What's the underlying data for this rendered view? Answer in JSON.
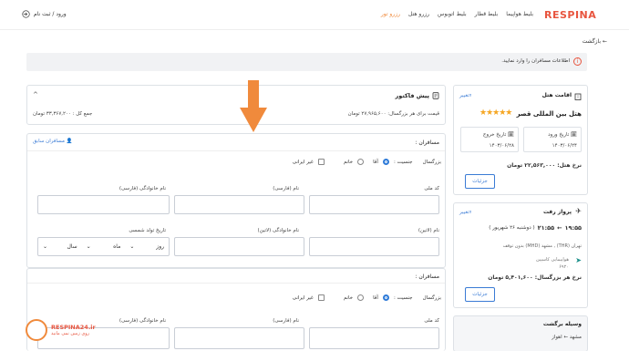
{
  "nav": {
    "logo": "RESPINA",
    "links": [
      "بلیط هواپیما",
      "بلیط قطار",
      "بلیط اتوبوس",
      "رزرو هتل",
      "رزرو تور"
    ],
    "login": "ورود / ثبت نام"
  },
  "back": "← بازگشت",
  "notice": "اطلاعات مسافران را وارد نمایید.",
  "hotel": {
    "header": "اقامت هتل",
    "change": "تغییر",
    "name": "هتل بین المللی قصر",
    "stars": "★★★★★",
    "checkin_label": "تاریخ ورود",
    "checkin": "۱۴۰۳/۰۶/۲۴",
    "checkout_label": "تاریخ خروج",
    "checkout": "۱۴۰۳/۰۶/۲۸",
    "rate_label": "نرخ هتل:",
    "rate": "۲۲,۵۶۳,۰۰۰ تومان",
    "details": "جزئیات"
  },
  "flight": {
    "header": "پرواز رفت",
    "change": "تغییر",
    "dep_time": "۱۹:۵۵",
    "arr_time": "۲۱:۵۵",
    "date": "( دوشنبه ۲۶ شهریور )",
    "route": "تهران (THR) , مشهد (MHD)  بدون توقف",
    "airline": "هواپیمایی کاسپین",
    "flight_no": "۶۹۲۰",
    "rate_label": "نرخ هر بزرگسال:",
    "rate": "۵,۴۰۱,۶۰۰ تومان",
    "details": "جزئیات"
  },
  "return": {
    "header": "وسیله برگشت",
    "route": "مشهد ← اهواز"
  },
  "factor": {
    "title": "پیش فاکتور",
    "per_adult": "قیمت برای هر بزرگسال: ۲۷,۹۶۵,۶۰۰ تومان",
    "total": "جمع کل : ۳۳,۳۶۷,۲۰۰ تومان"
  },
  "passenger": {
    "section_title": "مسافران :",
    "previous": "مسافران سابق",
    "type": "بزرگسال",
    "gender_label": "جنسیت :",
    "male": "آقا",
    "female": "خانم",
    "foreign": "غیر ایرانی",
    "national_code": "کد ملی",
    "first_fa": "نام (فارسی)",
    "last_fa": "نام خانوادگی (فارسی)",
    "first_en": "نام (لاتین)",
    "last_en": "نام خانوادگی (لاتین)",
    "birth": "تاریخ تولد شمسی",
    "day": "روز",
    "month": "ماه",
    "year": "سال"
  },
  "watermark": {
    "name": "RESPINA24.ir",
    "tagline": "روی زمین نمی مانید"
  },
  "colors": {
    "brand": "#e8553f",
    "accent": "#3a7bd5",
    "arrow": "#f08a3c"
  }
}
